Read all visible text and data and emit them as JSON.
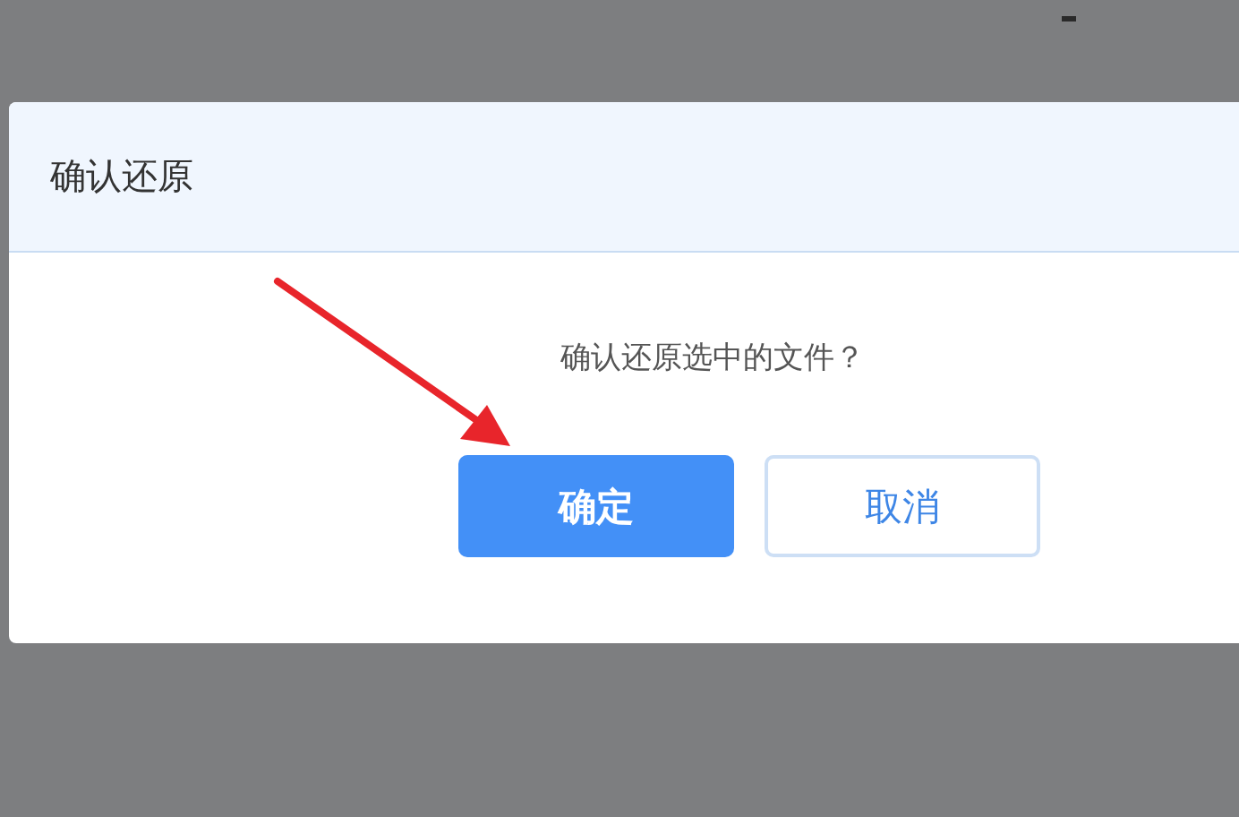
{
  "dialog": {
    "title": "确认还原",
    "message": "确认还原选中的文件？",
    "buttons": [
      {
        "label": "确定",
        "kind": "primary"
      },
      {
        "label": "取消",
        "kind": "secondary"
      }
    ]
  }
}
